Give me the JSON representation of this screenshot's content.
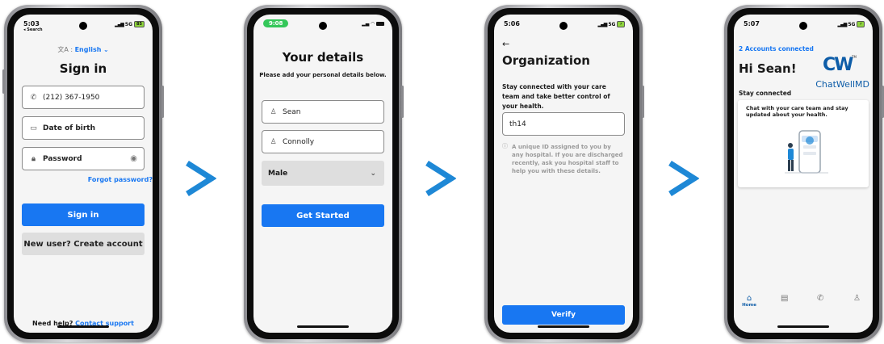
{
  "screen1": {
    "status_time": "5:03",
    "status_sub": "◂ Search",
    "status_net": "5G",
    "battery": "85",
    "language_label": "English",
    "title": "Sign in",
    "phone_value": "(212) 367-1950",
    "dob_placeholder": "Date of birth",
    "password_placeholder": "Password",
    "forgot_password": "Forgot password?",
    "sign_in_button": "Sign in",
    "create_account_button": "New user? Create account",
    "help_text": "Need help?",
    "contact_support": "Contact support"
  },
  "screen2": {
    "status_time": "9:08",
    "title": "Your details",
    "subtitle": "Please add your personal details below.",
    "first_name": "Sean",
    "last_name": "Connolly",
    "gender": "Male",
    "get_started_button": "Get Started"
  },
  "screen3": {
    "status_time": "5:06",
    "status_net": "5G",
    "title": "Organization",
    "description": "Stay connected with your care team and take better control of your health.",
    "org_id_value": "th14",
    "helper_text": "A unique ID assigned to you by any hospital. If you are discharged recently, ask you hospital staff to help you with these details.",
    "verify_button": "Verify"
  },
  "screen4": {
    "status_time": "5:07",
    "status_net": "5G",
    "accounts_connected": "2 Accounts connected",
    "greeting": "Hi Sean!",
    "logo_mark": "CW",
    "logo_tm": "TM",
    "logo_text": "ChatWellMD",
    "section_label": "Stay connected",
    "card_text": "Chat with your care team and stay updated about your health.",
    "nav_home": "Home"
  },
  "colors": {
    "primary": "#1877f2",
    "arrow": "#1e88d6",
    "status_green": "#34c759"
  }
}
